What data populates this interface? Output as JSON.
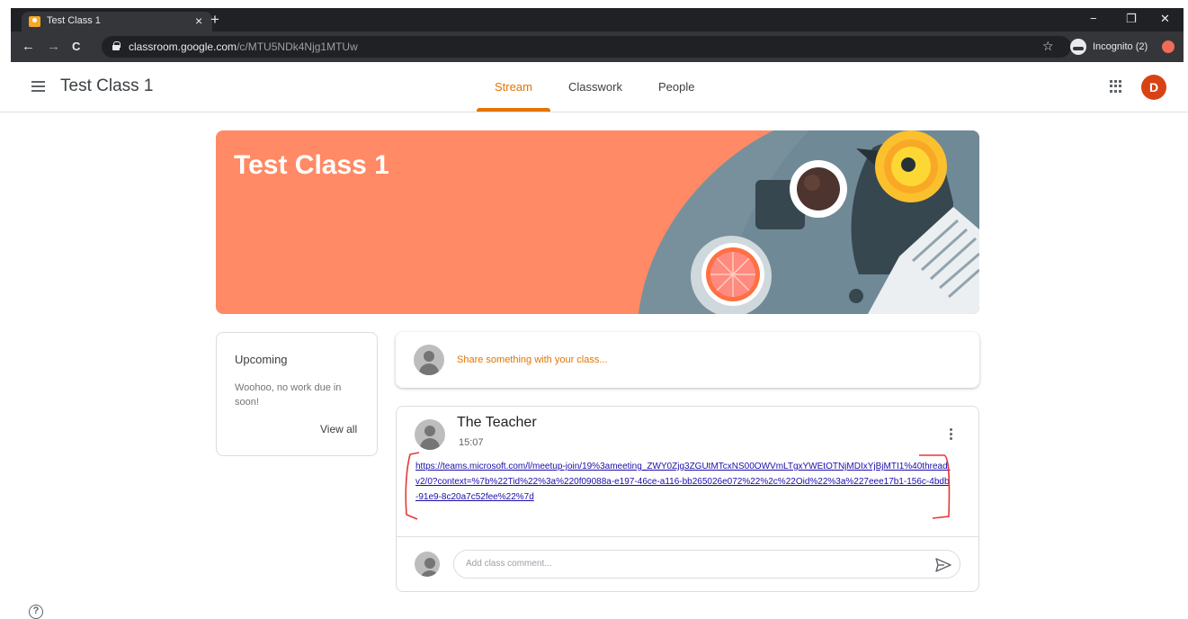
{
  "browser": {
    "tab_title": "Test Class 1",
    "tab_close": "×",
    "new_tab": "+",
    "url_host": "classroom.google.com",
    "url_path": "/c/MTU5NDk4Njg1MTUw",
    "incognito_label": "Incognito (2)",
    "window_controls": {
      "minimize": "−",
      "restore": "❐",
      "close": "✕"
    },
    "nav": {
      "back": "←",
      "forward": "→",
      "reload": "C"
    },
    "bookmark": "☆"
  },
  "header": {
    "class_title": "Test Class 1",
    "tabs": [
      {
        "label": "Stream",
        "active": true
      },
      {
        "label": "Classwork",
        "active": false
      },
      {
        "label": "People",
        "active": false
      }
    ],
    "avatar_initial": "D"
  },
  "banner": {
    "title": "Test Class 1",
    "color": "#ff8a65"
  },
  "upcoming": {
    "title": "Upcoming",
    "text": "Woohoo, no work due in soon!",
    "view_all": "View all"
  },
  "share": {
    "placeholder": "Share something with your class..."
  },
  "post": {
    "author": "The Teacher",
    "time": "15:07",
    "link": "https://teams.microsoft.com/l/meetup-join/19%3ameeting_ZWY0Zjg3ZGUtMTcxNS00OWVmLTgxYWEtOTNjMDIxYjBjMTI1%40thread.v2/0?context=%7b%22Tid%22%3a%220f09088a-e197-46ce-a116-bb265026e072%22%2c%22Oid%22%3a%227eee17b1-156c-4bdb-91e9-8c20a7c52fee%22%7d",
    "comment_placeholder": "Add class comment..."
  },
  "footer": {
    "help": "?"
  },
  "colors": {
    "accent": "#e37400",
    "avatar": "#d84315",
    "link": "#1a0dab"
  }
}
